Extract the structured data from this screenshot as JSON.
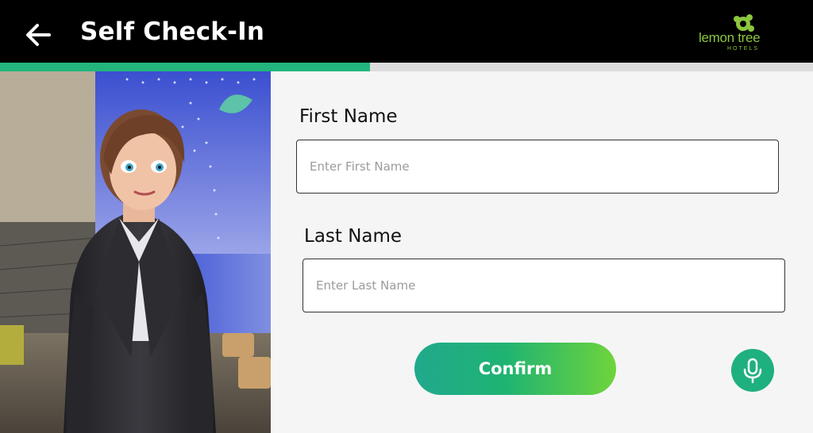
{
  "header": {
    "title": "Self Check-In",
    "back_icon": "arrow-left-icon",
    "logo": {
      "text": "lemon tree",
      "subtext": "HOTELS",
      "color": "#8cc63f"
    }
  },
  "progress": {
    "fraction": 0.455,
    "color": "#22b57c"
  },
  "form": {
    "first_name": {
      "label": "First Name",
      "placeholder": "Enter First Name",
      "value": ""
    },
    "last_name": {
      "label": "Last Name",
      "placeholder": "Enter Last Name",
      "value": ""
    },
    "confirm_label": "Confirm",
    "mic_icon": "microphone-icon"
  },
  "colors": {
    "accent": "#1fb07f",
    "gradient_end": "#6fd43b",
    "header_bg": "#000000"
  }
}
